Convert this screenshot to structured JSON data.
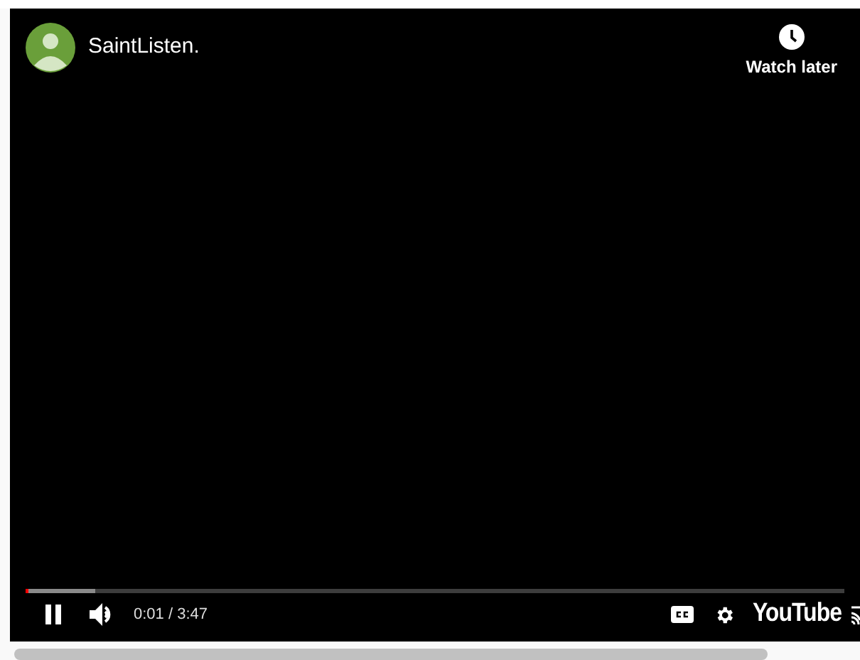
{
  "player": {
    "channel_name": "SaintListen.",
    "watch_later": {
      "label": "Watch later"
    },
    "progress": {
      "level": 0.004,
      "buffered": {
        "level": 0.085
      }
    },
    "controls": {
      "playing": true,
      "muted": false,
      "time": "0:01 / 3:47",
      "logo": "YouTube"
    }
  }
}
